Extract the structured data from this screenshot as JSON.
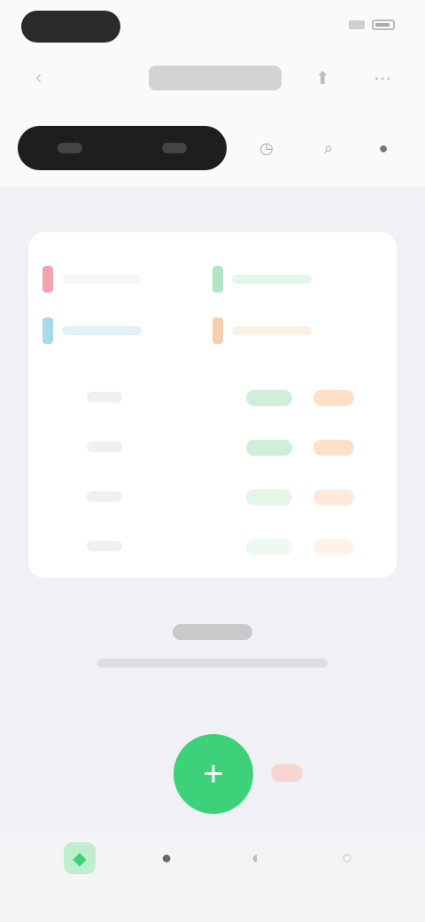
{
  "status": {
    "time_label": "",
    "battery_label": ""
  },
  "header": {
    "back_glyph": "‹",
    "title": "",
    "icon_share": "⬆",
    "icon_more": "⋯"
  },
  "filters": {
    "chip_left": "",
    "chip_right": "",
    "btn_a": "◷",
    "btn_b": "⌕",
    "btn_c": "●"
  },
  "legend": [
    {
      "color": "#f2a3ad",
      "text": ""
    },
    {
      "color": "#aee6c3",
      "text": ""
    },
    {
      "color": "#a8dbe9",
      "text": ""
    },
    {
      "color": "#f6cfae",
      "text": ""
    }
  ],
  "rows": [
    {
      "green": "",
      "orange": ""
    },
    {
      "green": "",
      "orange": ""
    },
    {
      "green": "",
      "orange": ""
    },
    {
      "green": "",
      "orange": ""
    }
  ],
  "message": {
    "title": "",
    "subtitle": ""
  },
  "fab": {
    "glyph": "+"
  },
  "tabs": [
    {
      "icon": "◆",
      "label": "",
      "active": true
    },
    {
      "icon": "●",
      "label": "",
      "active": false
    },
    {
      "icon": "◐",
      "label": "",
      "active": false
    },
    {
      "icon": "○",
      "label": "",
      "active": false
    }
  ],
  "colors": {
    "accent": "#3dd27a",
    "dark": "#1e1e1e",
    "background": "#f1f1f5"
  }
}
